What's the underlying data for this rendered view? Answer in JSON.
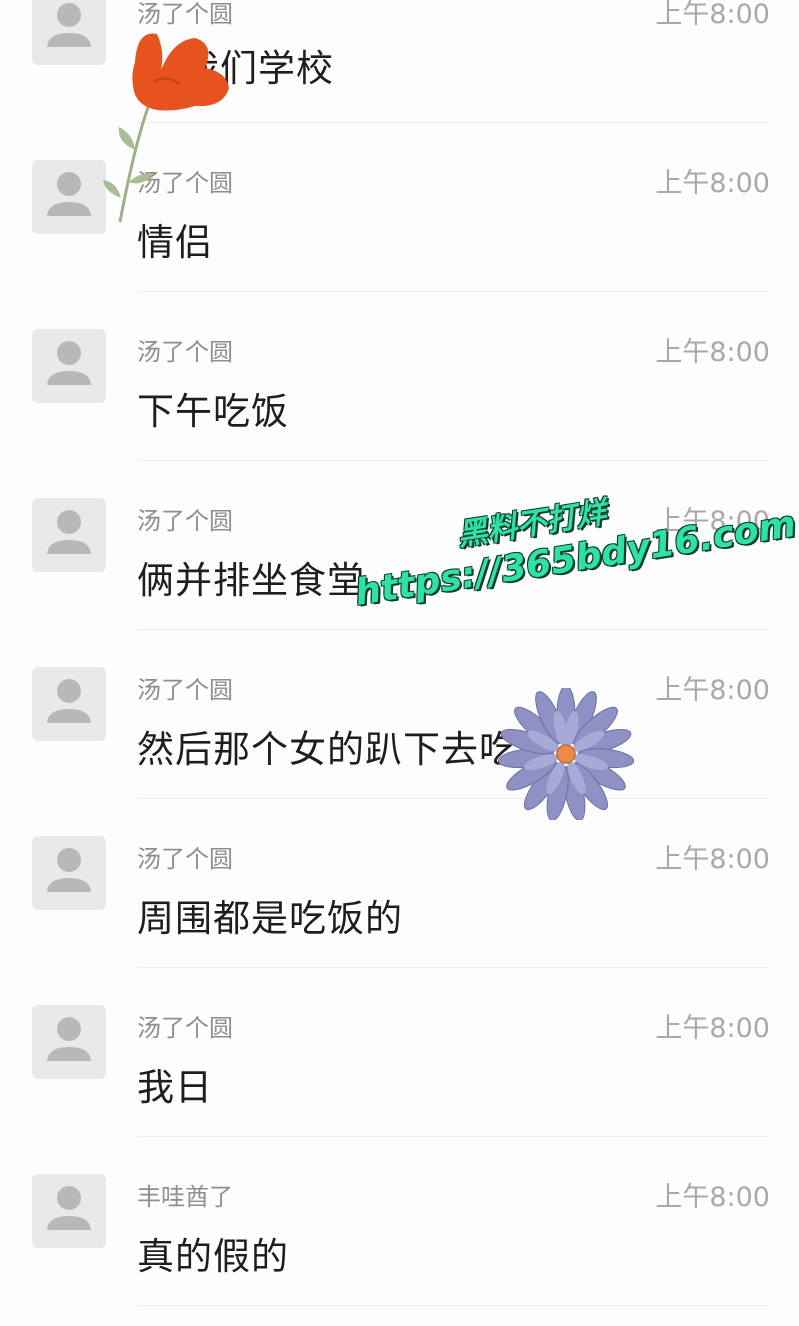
{
  "messages": [
    {
      "sender": "汤了个圆",
      "time": "上午8:00",
      "text": "我们学校"
    },
    {
      "sender": "汤了个圆",
      "time": "上午8:00",
      "text": "情侣"
    },
    {
      "sender": "汤了个圆",
      "time": "上午8:00",
      "text": "下午吃饭"
    },
    {
      "sender": "汤了个圆",
      "time": "上午8:00",
      "text": "俩并排坐食堂"
    },
    {
      "sender": "汤了个圆",
      "time": "上午8:00",
      "text": "然后那个女的趴下去吃"
    },
    {
      "sender": "汤了个圆",
      "time": "上午8:00",
      "text": "周围都是吃饭的"
    },
    {
      "sender": "汤了个圆",
      "time": "上午8:00",
      "text": "我日"
    },
    {
      "sender": "丰哇酋了",
      "time": "上午8:00",
      "text": "真的假的"
    }
  ],
  "watermark": {
    "line1": "黑料不打烊",
    "line2": "https://365bdy16.com",
    "color": "#2fe0a9"
  },
  "stickers": {
    "top": "red-flower-sticker",
    "middle": "purple-daisy-sticker"
  },
  "colors": {
    "background": "#fdfdfd",
    "sender": "#8e8e8e",
    "time": "#a9a9a9",
    "message": "#1e1e1e",
    "avatar_bg": "#e9e9e9",
    "avatar_fg": "#b8b8b8"
  }
}
